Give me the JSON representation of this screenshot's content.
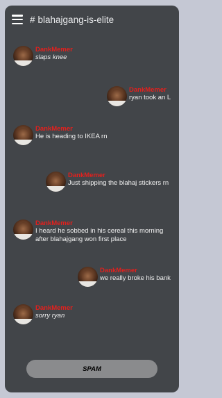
{
  "header": {
    "hash": "#",
    "channel_name": "blahajgang-is-elite"
  },
  "messages": [
    {
      "author": "DankMemer",
      "text": "slaps knee",
      "italic": true
    },
    {
      "author": "DankMemer",
      "text": "ryan took an L",
      "italic": false
    },
    {
      "author": "DankMemer",
      "text": "He is heading to IKEA rn",
      "italic": false
    },
    {
      "author": "DankMemer",
      "text": "Just shipping the blahaj stickers rn",
      "italic": false
    },
    {
      "author": "DankMemer",
      "text_line1": "I heard he sobbed in his cereal this morning",
      "text_line2": "after blahajgang won first place",
      "italic": false
    },
    {
      "author": "DankMemer",
      "text": "we really broke his bank",
      "italic": false
    },
    {
      "author": "DankMemer",
      "text": "sorry ryan",
      "italic": true
    }
  ],
  "spam_button": {
    "label": "SPAM"
  },
  "colors": {
    "background": "#c5c8d4",
    "panel": "#424549",
    "author": "#e3201d",
    "text": "#f2f2f2",
    "button": "#8a8b8d"
  },
  "icons": {
    "menu": "hamburger-menu-icon",
    "avatar": "user-avatar-photo"
  }
}
